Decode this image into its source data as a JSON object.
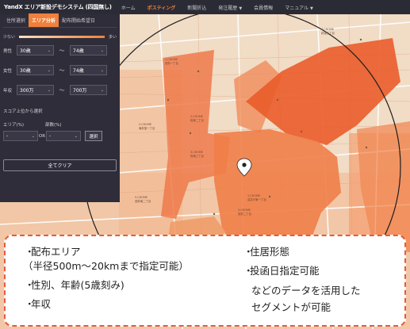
{
  "nav": {
    "brand": "YandX エリア新設デモシステム (四国無し)",
    "items": [
      {
        "label": "ホーム",
        "active": false,
        "dropdown": false
      },
      {
        "label": "ポスティング",
        "active": true,
        "dropdown": false
      },
      {
        "label": "新聞折込",
        "active": false,
        "dropdown": false
      },
      {
        "label": "発注履歴",
        "active": false,
        "dropdown": true
      },
      {
        "label": "会員情報",
        "active": false,
        "dropdown": false
      },
      {
        "label": "マニュアル",
        "active": false,
        "dropdown": true
      }
    ]
  },
  "panel": {
    "tabs": [
      "住所選択",
      "エリア分析",
      "配布開始希望日"
    ],
    "active_tab": "エリア分析",
    "scale": {
      "low": "少ない",
      "high": "多い"
    },
    "filters": [
      {
        "label": "男性",
        "from": "30歳",
        "to": "74歳"
      },
      {
        "label": "女性",
        "from": "30歳",
        "to": "74歳"
      },
      {
        "label": "年収",
        "from": "300万",
        "to": "700万"
      }
    ],
    "score_title": "スコア上位から選択",
    "area_label": "エリア(%)",
    "count_label": "部数(%)",
    "area_value": "-",
    "count_value": "-",
    "or_label": "OR",
    "select_button": "選択",
    "clear_button": "全てクリア"
  },
  "map": {
    "accent": "#f0803c",
    "labels": [
      "1-CHOME",
      "2-CHOME",
      "3-CHOME",
      "4-CHOME",
      "5-CHOME",
      "宮前一丁目",
      "松庵二丁目",
      "松庵三丁目",
      "高井戸東一丁目",
      "宮前二丁目",
      "荻窪三丁目",
      "南荻窪一丁目",
      "西荻南二丁目"
    ]
  },
  "callout": {
    "left": [
      "配布エリア",
      "（半径500m～20kmまで指定可能）",
      "性別、年齢(5歳刻み)",
      "年収"
    ],
    "right": [
      "住居形態",
      "投函日指定可能",
      "などのデータを活用した",
      "セグメントが可能"
    ]
  },
  "colors": {
    "accent": "#f0803c",
    "panel": "#2f2d39",
    "dash": "#e55b3e"
  }
}
